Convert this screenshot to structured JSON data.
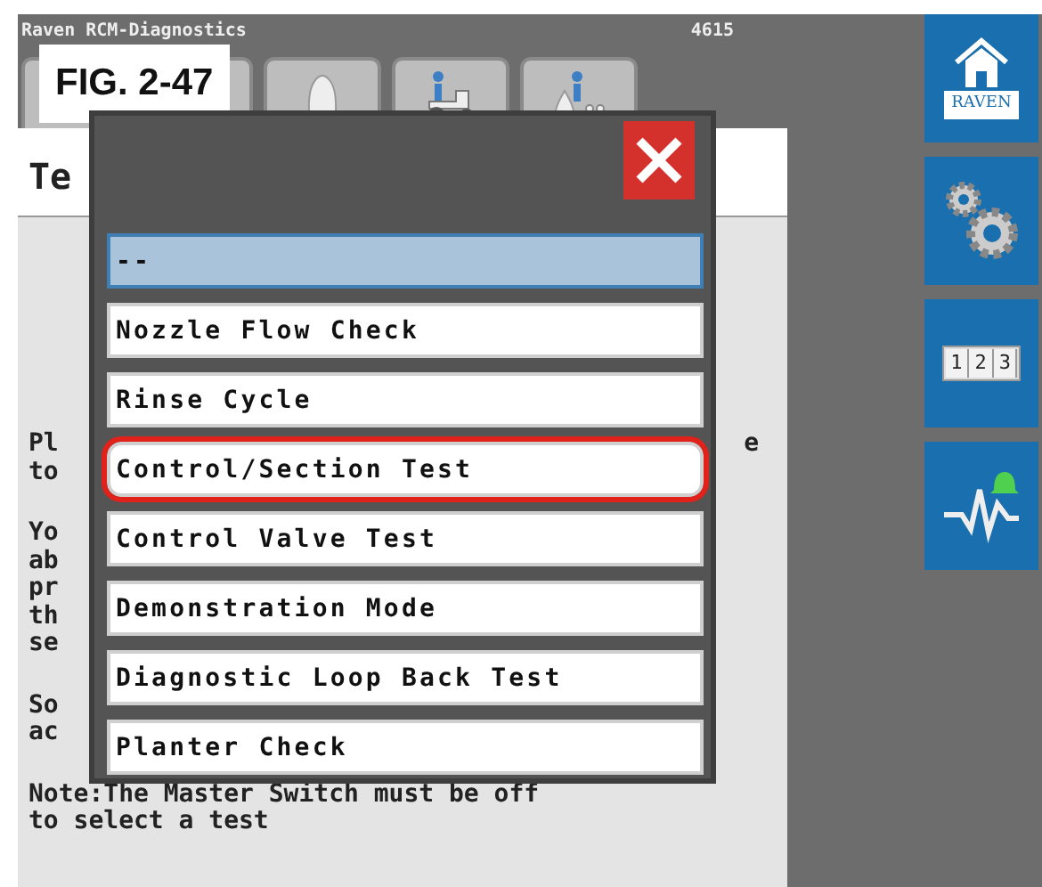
{
  "window": {
    "title": "Raven RCM-Diagnostics",
    "code": "4615"
  },
  "figure_label": "FIG. 2-47",
  "tabs": [
    {
      "kind": "blank"
    },
    {
      "kind": "nozzle"
    },
    {
      "kind": "tractor"
    },
    {
      "kind": "product"
    }
  ],
  "panel": {
    "title": "Te",
    "paragraphs": [
      [
        {
          "start": "Pl",
          "end": "e"
        },
        {
          "start": "to"
        }
      ],
      [
        {
          "start": "Yo"
        },
        {
          "start": "ab"
        },
        {
          "start": "pr"
        },
        {
          "start": "th"
        },
        {
          "start": "se"
        }
      ],
      [
        {
          "start": "So"
        },
        {
          "start": "ac"
        }
      ],
      [
        {
          "start": "Note:The Master Switch must be off"
        },
        {
          "start": "to select a test"
        }
      ]
    ]
  },
  "dialog": {
    "items": [
      {
        "label": "--",
        "selected": true,
        "highlighted": false
      },
      {
        "label": "Nozzle Flow Check",
        "selected": false,
        "highlighted": false
      },
      {
        "label": "Rinse Cycle",
        "selected": false,
        "highlighted": false
      },
      {
        "label": "Control/Section Test",
        "selected": false,
        "highlighted": true
      },
      {
        "label": "Control Valve Test",
        "selected": false,
        "highlighted": false
      },
      {
        "label": "Demonstration Mode",
        "selected": false,
        "highlighted": false
      },
      {
        "label": "Diagnostic Loop Back Test",
        "selected": false,
        "highlighted": false
      },
      {
        "label": "Planter Check",
        "selected": false,
        "highlighted": false
      }
    ]
  },
  "sidebar": [
    {
      "kind": "home",
      "label": "RAVEN"
    },
    {
      "kind": "settings"
    },
    {
      "kind": "counter",
      "digits": [
        "1",
        "2",
        "3"
      ]
    },
    {
      "kind": "diagnostics"
    }
  ]
}
